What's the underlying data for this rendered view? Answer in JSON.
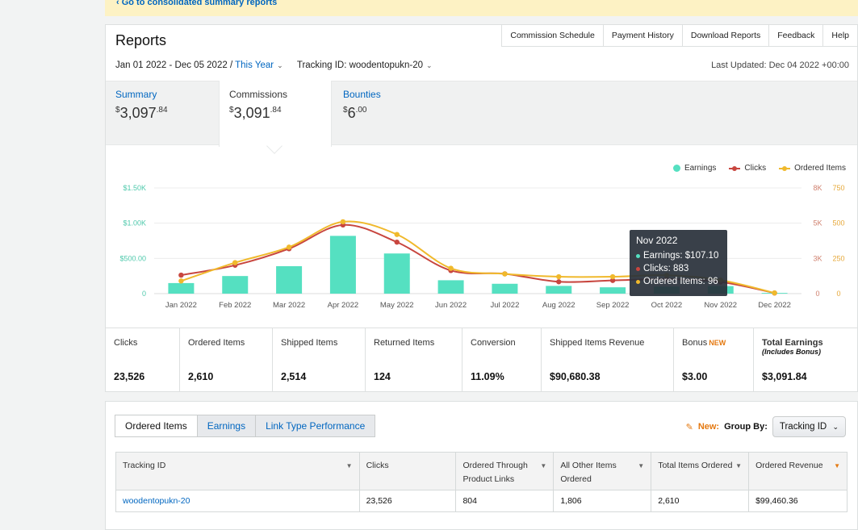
{
  "banner": {
    "link": "‹ Go to consolidated summary reports"
  },
  "header": {
    "title": "Reports",
    "links": [
      "Commission Schedule",
      "Payment History",
      "Download Reports",
      "Feedback",
      "Help"
    ],
    "date_range": "Jan 01 2022 - Dec 05 2022",
    "date_preset": "This Year",
    "tracking_label": "Tracking ID:",
    "tracking_value": "woodentopukn-20",
    "last_updated": "Last Updated: Dec 04 2022 +00:00"
  },
  "summary_tabs": [
    {
      "label": "Summary",
      "currency": "$",
      "whole": "3,097",
      "cents": ".84"
    },
    {
      "label": "Commissions",
      "currency": "$",
      "whole": "3,091",
      "cents": ".84"
    },
    {
      "label": "Bounties",
      "currency": "$",
      "whole": "6",
      "cents": ".00"
    }
  ],
  "legend": {
    "earnings": "Earnings",
    "clicks": "Clicks",
    "ordered": "Ordered Items"
  },
  "colors": {
    "earnings": "#55e0c1",
    "clicks": "#c8463f",
    "ordered": "#f0b92c",
    "link": "#0066c0",
    "accent": "#e47911"
  },
  "chart_data": {
    "type": "bar",
    "categories": [
      "Jan 2022",
      "Feb 2022",
      "Mar 2022",
      "Apr 2022",
      "May 2022",
      "Jun 2022",
      "Jul 2022",
      "Aug 2022",
      "Sep 2022",
      "Oct 2022",
      "Nov 2022",
      "Dec 2022"
    ],
    "series": [
      {
        "name": "Earnings",
        "type": "bar",
        "axis": "left",
        "values": [
          150,
          250,
          390,
          820,
          570,
          190,
          140,
          110,
          90,
          100,
          107.1,
          10
        ]
      },
      {
        "name": "Clicks",
        "type": "line",
        "axis": "right",
        "values": [
          1400,
          2150,
          3400,
          5200,
          3900,
          1750,
          1500,
          900,
          1000,
          1100,
          883,
          50
        ]
      },
      {
        "name": "Ordered Items",
        "type": "line",
        "axis": "right2",
        "values": [
          90,
          220,
          330,
          510,
          420,
          180,
          140,
          120,
          120,
          130,
          96,
          5
        ]
      }
    ],
    "yleft_ticks": [
      "0",
      "$500.00",
      "$1.00K",
      "$1.50K"
    ],
    "yleft_max": 1500,
    "yright_ticks": [
      "0",
      "3K",
      "5K",
      "8K"
    ],
    "yright_max": 8000,
    "yright2_ticks": [
      "0",
      "250",
      "500",
      "750"
    ],
    "yright2_max": 750,
    "grid": true,
    "legend_position": "top-right"
  },
  "tooltip": {
    "title": "Nov 2022",
    "earnings": "Earnings: $107.10",
    "clicks": "Clicks: 883",
    "ordered": "Ordered Items: 96"
  },
  "metrics": [
    {
      "label": "Clicks",
      "value": "23,526"
    },
    {
      "label": "Ordered Items",
      "value": "2,610"
    },
    {
      "label": "Shipped Items",
      "value": "2,514"
    },
    {
      "label": "Returned Items",
      "value": "124"
    },
    {
      "label": "Conversion",
      "value": "11.09%"
    },
    {
      "label": "Shipped Items Revenue",
      "value": "$90,680.38"
    },
    {
      "label": "Bonus",
      "badge": "NEW",
      "value": "$3.00"
    },
    {
      "label": "Total Earnings",
      "sub": "(Includes Bonus)",
      "value": "$3,091.84"
    }
  ],
  "bottom": {
    "tabs": [
      "Ordered Items",
      "Earnings",
      "Link Type Performance"
    ],
    "group_new": "New:",
    "group_label": "Group By:",
    "group_value": "Tracking ID",
    "columns": [
      "Tracking ID",
      "Clicks",
      "Ordered Through Product Links",
      "All Other Items Ordered",
      "Total Items Ordered",
      "Ordered Revenue"
    ],
    "rows": [
      [
        "woodentopukn-20",
        "23,526",
        "804",
        "1,806",
        "2,610",
        "$99,460.36"
      ]
    ]
  }
}
